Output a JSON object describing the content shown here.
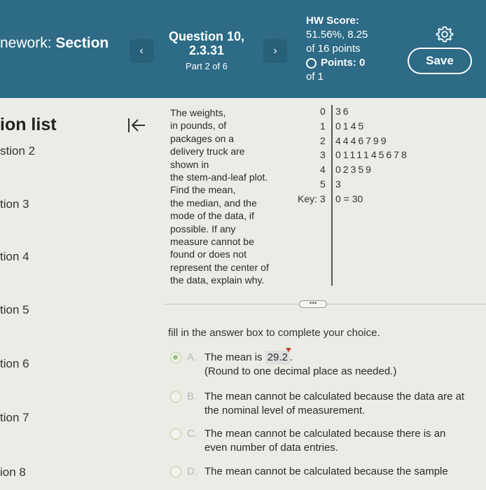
{
  "header": {
    "title_prefix": "nework: ",
    "title_bold": "Section",
    "prev_icon": "‹",
    "next_icon": "›",
    "question_title": "Question 10,",
    "question_number": "2.3.31",
    "question_part": "Part 2 of 6",
    "hw_label": "HW Score:",
    "hw_score": "51.56%, 8.25",
    "hw_of": "of 16 points",
    "points_label": "Points: 0",
    "points_of": "of 1",
    "save_label": "Save"
  },
  "sidebar": {
    "title": "ion list",
    "items": [
      "stion 2",
      "tion 3",
      "tion 4",
      "tion 5",
      "tion 6",
      "tion 7",
      "ion 8"
    ]
  },
  "question": {
    "lines": [
      "The weights,",
      "in pounds, of",
      "packages on a",
      "delivery truck are",
      "shown in",
      "the stem-and-leaf plot.",
      "Find the mean,",
      "the median, and the",
      "mode of the data, if",
      "possible. If any",
      "measure cannot be",
      "found or does not",
      "represent the center of",
      "the data, explain why."
    ]
  },
  "stem_leaf": {
    "rows": [
      {
        "stem": "0",
        "leaves": "36"
      },
      {
        "stem": "1",
        "leaves": "0145"
      },
      {
        "stem": "2",
        "leaves": "4446799"
      },
      {
        "stem": "3",
        "leaves": "0111145678"
      },
      {
        "stem": "4",
        "leaves": "02359"
      },
      {
        "stem": "5",
        "leaves": "3"
      }
    ],
    "key_label": "Key: 3",
    "key_leaf": "0 = 30"
  },
  "answer": {
    "instruction": "fill in the answer box to complete your choice.",
    "options": [
      {
        "letter": "A.",
        "text": "The mean is ",
        "value": "29.2",
        "suffix": ".",
        "note": "(Round to one decimal place as needed.)",
        "selected": true
      },
      {
        "letter": "B.",
        "line1": "The mean cannot be calculated because the data are at",
        "line2": "the nominal level of measurement.",
        "selected": false
      },
      {
        "letter": "C.",
        "line1": "The mean cannot be calculated because there is an",
        "line2": "even number of data entries.",
        "selected": false
      },
      {
        "letter": "D.",
        "line1": "The mean cannot be calculated because the sample",
        "selected": false
      }
    ]
  }
}
